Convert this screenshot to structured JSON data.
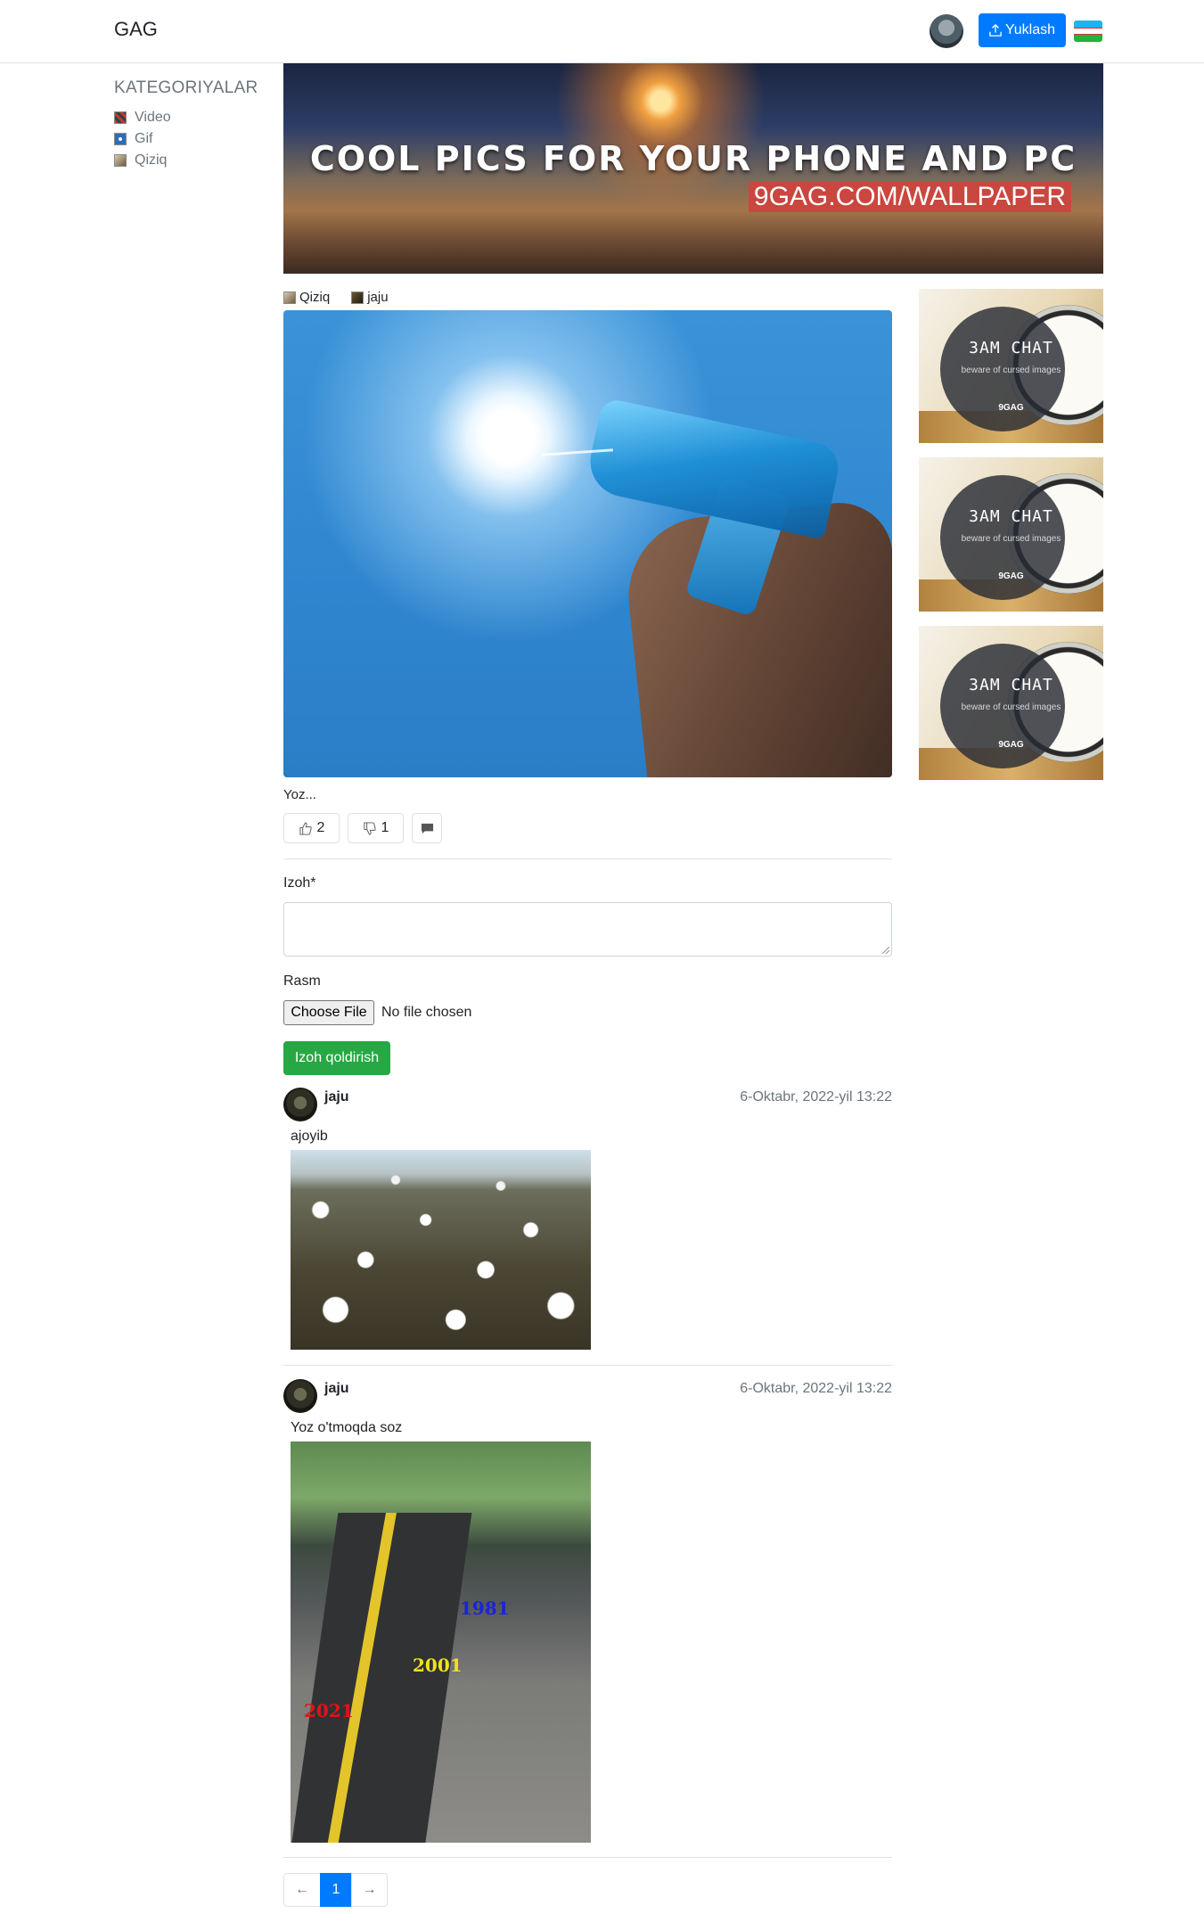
{
  "navbar": {
    "brand": "GAG",
    "upload_label": "Yuklash"
  },
  "sidebar": {
    "title": "KATEGORIYALAR",
    "items": [
      {
        "label": "Video",
        "icon": "video-icon"
      },
      {
        "label": "Gif",
        "icon": "gif-icon"
      },
      {
        "label": "Qiziq",
        "icon": "qiziq-icon"
      }
    ]
  },
  "banner": {
    "title": "COOL PICS FOR YOUR PHONE AND PC",
    "subtitle": "9GAG.COM/WALLPAPER"
  },
  "post": {
    "category": "Qiziq",
    "author": "jaju",
    "caption": "Yoz...",
    "likes": "2",
    "dislikes": "1"
  },
  "comment_form": {
    "comment_label": "Izoh*",
    "image_label": "Rasm",
    "choose_file_label": "Choose File",
    "no_file_text": "No file chosen",
    "submit_label": "Izoh qoldirish"
  },
  "comments": [
    {
      "user": "jaju",
      "date": "6-Oktabr, 2022-yil 13:22",
      "text": "ajoyib"
    },
    {
      "user": "jaju",
      "date": "6-Oktabr, 2022-yil 13:22",
      "text": "Yoz o'tmoqda soz",
      "image_labels": [
        "1981",
        "2001",
        "2021"
      ]
    }
  ],
  "pagination": {
    "prev": "←",
    "current": "1",
    "next": "→"
  },
  "ads": [
    {
      "title": "3AM CHAT",
      "subtitle": "beware of cursed images",
      "brand": "9GAG"
    },
    {
      "title": "3AM CHAT",
      "subtitle": "beware of cursed images",
      "brand": "9GAG"
    },
    {
      "title": "3AM CHAT",
      "subtitle": "beware of cursed images",
      "brand": "9GAG"
    }
  ],
  "colors": {
    "primary": "#007bff",
    "success": "#28a745",
    "muted": "#6c757d"
  }
}
